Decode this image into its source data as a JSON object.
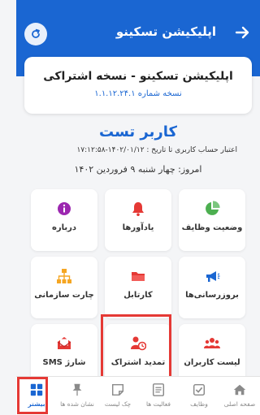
{
  "header": {
    "title": "اپلیکیشن تسکینو"
  },
  "version_card": {
    "title": "اپلیکیشن تسکینو - نسخه اشتراکی",
    "version": "نسخه شماره ۱.۱.۱۲.۲۴.۱"
  },
  "user": {
    "name": "کاربر تست",
    "account_valid": "اعتبار حساب کاربری تا تاریخ : ۱۴۰۲/۰۱/۱۲-۱۷:۱۲:۵۸",
    "today": "امروز: چهار شنبه ۹ فروردین ۱۴۰۲"
  },
  "tiles": [
    {
      "label": "وضعیت وظایف",
      "icon": "pie-chart-icon"
    },
    {
      "label": "یادآورها",
      "icon": "bell-icon"
    },
    {
      "label": "درباره",
      "icon": "info-icon"
    },
    {
      "label": "بروزرسانی‌ها",
      "icon": "megaphone-icon"
    },
    {
      "label": "کارتابل",
      "icon": "folder-icon"
    },
    {
      "label": "چارت سازمانی",
      "icon": "org-chart-icon"
    },
    {
      "label": "لیست کاربران",
      "icon": "users-icon"
    },
    {
      "label": "تمدید اشتراک",
      "icon": "user-clock-icon"
    },
    {
      "label": "شارژ SMS",
      "icon": "sms-envelope-icon"
    }
  ],
  "nav": [
    {
      "label": "صفحه اصلی",
      "icon": "home-icon"
    },
    {
      "label": "وظایف",
      "icon": "check-square-icon"
    },
    {
      "label": "فعالیت ها",
      "icon": "list-icon"
    },
    {
      "label": "چک لیست",
      "icon": "note-icon"
    },
    {
      "label": "نشان شده ها",
      "icon": "pin-icon"
    },
    {
      "label": "بیشتر",
      "icon": "grid-icon"
    }
  ],
  "colors": {
    "brand": "#1a66d2",
    "highlight": "#e53935",
    "green": "#4caf50",
    "red": "#e53935",
    "purple": "#9c27b0",
    "orange": "#f5a623"
  }
}
